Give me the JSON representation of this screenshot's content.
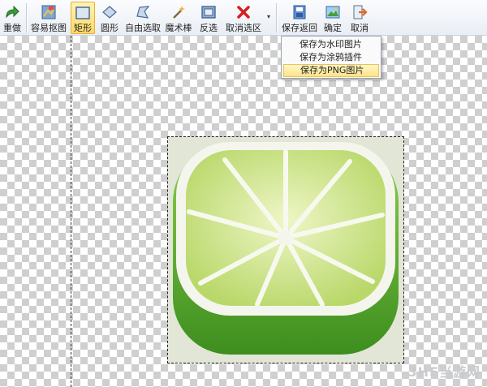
{
  "toolbar": {
    "buttons": [
      {
        "label": "重做",
        "icon": "redo-arrow-icon"
      },
      {
        "label": "容易抠图",
        "icon": "easy-cutout-icon"
      },
      {
        "label": "矩形",
        "icon": "rectangle-select-icon",
        "active": true
      },
      {
        "label": "圆形",
        "icon": "ellipse-select-icon"
      },
      {
        "label": "自由选取",
        "icon": "lasso-select-icon"
      },
      {
        "label": "魔术棒",
        "icon": "magic-wand-icon"
      },
      {
        "label": "反选",
        "icon": "invert-selection-icon"
      },
      {
        "label": "取消选区",
        "icon": "cancel-selection-icon"
      },
      {
        "label": "保存返回",
        "icon": "save-return-icon"
      },
      {
        "label": "确定",
        "icon": "confirm-icon"
      },
      {
        "label": "取消",
        "icon": "cancel-exit-icon"
      }
    ],
    "dropdown_arrow": "▾"
  },
  "save_menu": {
    "items": [
      {
        "label": "保存为水印图片"
      },
      {
        "label": "保存为涂鸦插件"
      },
      {
        "label": "保存为PNG图片",
        "highlighted": true
      }
    ]
  },
  "watermark": "3HE当游网",
  "colors": {
    "active_button": "#ffd968",
    "menu_highlight": "#ffe38a",
    "lime_rind": "#5cab2a",
    "lime_flesh": "#c6e07a"
  }
}
